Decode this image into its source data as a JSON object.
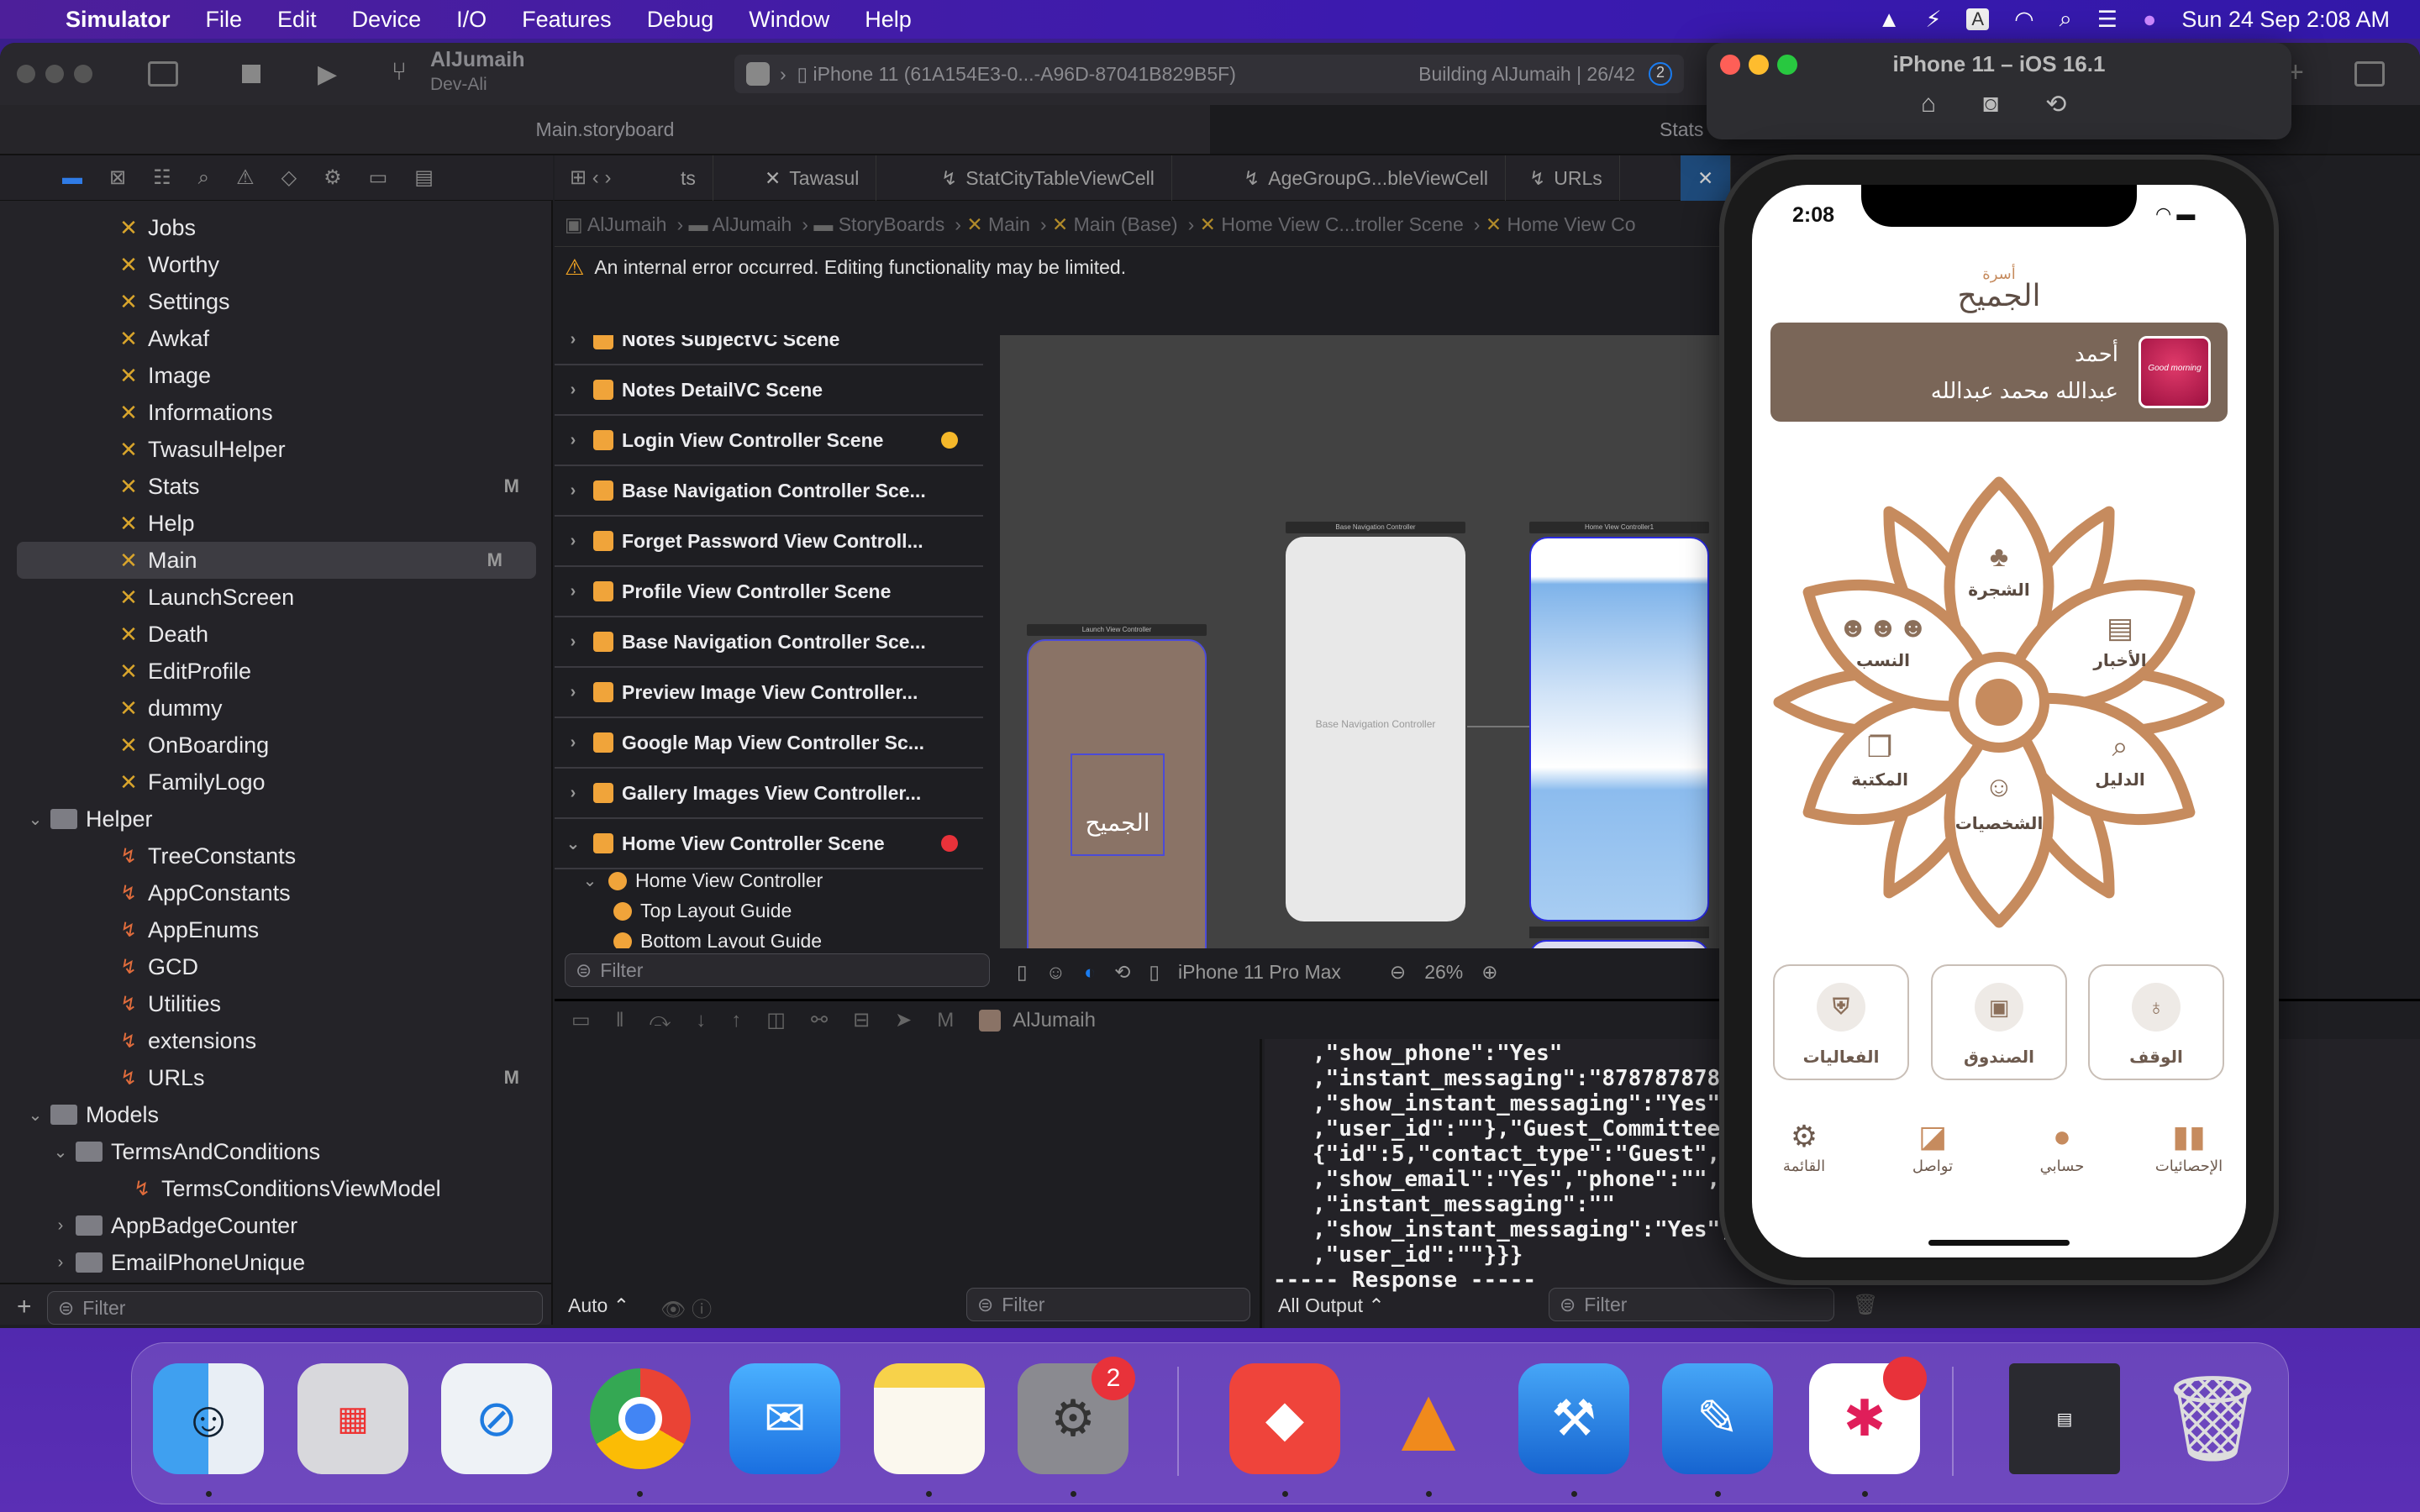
{
  "menubar": {
    "app": "Simulator",
    "items": [
      "File",
      "Edit",
      "Device",
      "I/O",
      "Features",
      "Debug",
      "Window",
      "Help"
    ],
    "clock": "Sun 24 Sep  2:08 AM"
  },
  "xcode": {
    "project": "AlJumaih",
    "branch": "Dev-Ali",
    "scheme_device": "iPhone 11 (61A154E3-0...-A96D-87041B829B5F)",
    "status": "Building AlJumaih | 26/42",
    "status_count": "2",
    "file_tab": "Main.storyboard",
    "file_tab2": "Stats",
    "editor_tabs": [
      "ts",
      "Tawasul",
      "StatCityTableViewCell",
      "AgeGroupG...bleViewCell",
      "URLs"
    ],
    "breadcrumb": [
      "AlJumaih",
      "AlJumaih",
      "StoryBoards",
      "Main",
      "Main (Base)",
      "Home View C...troller Scene",
      "Home View Co"
    ],
    "warning": "An internal error occurred. Editing functionality may be limited.",
    "navigator": [
      {
        "label": "Jobs",
        "type": "sb",
        "level": 2
      },
      {
        "label": "Worthy",
        "type": "sb",
        "level": 2
      },
      {
        "label": "Settings",
        "type": "sb",
        "level": 2
      },
      {
        "label": "Awkaf",
        "type": "sb",
        "level": 2
      },
      {
        "label": "Image",
        "type": "sb",
        "level": 2
      },
      {
        "label": "Informations",
        "type": "sb",
        "level": 2
      },
      {
        "label": "TwasulHelper",
        "type": "sb",
        "level": 2
      },
      {
        "label": "Stats",
        "type": "sb",
        "level": 2,
        "badge": "M"
      },
      {
        "label": "Help",
        "type": "sb",
        "level": 2
      },
      {
        "label": "Main",
        "type": "sb",
        "level": 2,
        "badge": "M",
        "selected": true
      },
      {
        "label": "LaunchScreen",
        "type": "sb",
        "level": 2
      },
      {
        "label": "Death",
        "type": "sb",
        "level": 2
      },
      {
        "label": "EditProfile",
        "type": "sb",
        "level": 2
      },
      {
        "label": "dummy",
        "type": "sb",
        "level": 2
      },
      {
        "label": "OnBoarding",
        "type": "sb",
        "level": 2
      },
      {
        "label": "FamilyLogo",
        "type": "sb",
        "level": 2
      },
      {
        "label": "Helper",
        "type": "folder",
        "level": 1,
        "open": true
      },
      {
        "label": "TreeConstants",
        "type": "swift",
        "level": 2
      },
      {
        "label": "AppConstants",
        "type": "swift",
        "level": 2
      },
      {
        "label": "AppEnums",
        "type": "swift",
        "level": 2
      },
      {
        "label": "GCD",
        "type": "swift",
        "level": 2
      },
      {
        "label": "Utilities",
        "type": "swift",
        "level": 2
      },
      {
        "label": "extensions",
        "type": "swift",
        "level": 2
      },
      {
        "label": "URLs",
        "type": "swift",
        "level": 2,
        "badge": "M"
      },
      {
        "label": "Models",
        "type": "folder",
        "level": 1,
        "open": true
      },
      {
        "label": "TermsAndConditions",
        "type": "folder",
        "level": 2,
        "open": true
      },
      {
        "label": "TermsConditionsViewModel",
        "type": "swift",
        "level": 3
      },
      {
        "label": "AppBadgeCounter",
        "type": "folder",
        "level": 2,
        "open": false
      },
      {
        "label": "EmailPhoneUnique",
        "type": "folder",
        "level": 2,
        "open": false
      }
    ],
    "sidebar_filter": "Filter",
    "outline": [
      {
        "label": "Notes SubjectVC Scene"
      },
      {
        "label": "Notes DetailVC Scene"
      },
      {
        "label": "Login View Controller Scene",
        "marker": "yellow"
      },
      {
        "label": "Base Navigation Controller Sce..."
      },
      {
        "label": "Forget Password View Controll..."
      },
      {
        "label": "Profile View Controller Scene"
      },
      {
        "label": "Base Navigation Controller Sce..."
      },
      {
        "label": "Preview Image View Controller..."
      },
      {
        "label": "Google Map View Controller Sc..."
      },
      {
        "label": "Gallery Images View Controller..."
      },
      {
        "label": "Home View Controller Scene",
        "marker": "red",
        "open": true
      }
    ],
    "outline_children": [
      "Home View Controller",
      "Top Layout Guide",
      "Bottom Layout Guide"
    ],
    "outline_filter": "Filter",
    "scenes": {
      "launch": "Launch View Controller",
      "nav": "Base Navigation Controller",
      "nav_body": "Base Navigation Controller",
      "home": "Home View Controller1"
    },
    "canvas_device": "iPhone 11 Pro Max",
    "zoom": "26%",
    "debug_target": "AlJumaih",
    "variables_mode": "Auto",
    "variables_filter": "Filter",
    "console_lines": [
      "   ,\"show_phone\":\"Yes\"",
      "   ,\"instant_messaging\":\"87878787878",
      "   ,\"show_instant_messaging\":\"Yes\",",
      "   ,\"user_id\":\"\"},\"Guest_Committee_",
      "   {\"id\":5,\"contact_type\":\"Guest\",\"",
      "   ,\"show_email\":\"Yes\",\"phone\":\"\",\"",
      "   ,\"instant_messaging\":\"\"",
      "   ,\"show_instant_messaging\":\"Yes\",",
      "   ,\"user_id\":\"\"}}}",
      "----- Response -----"
    ],
    "console_mode": "All Output",
    "console_filter": "Filter"
  },
  "simulator": {
    "title": "iPhone 11 – iOS 16.1",
    "time": "2:08",
    "logo_top": "أسرة",
    "logo": "الجميح",
    "user_first": "أحمد",
    "user_full": "عبدالله محمد عبدالله",
    "avatar_text": "Good morning",
    "petals": [
      "الشجرة",
      "الأخبار",
      "الدليل",
      "الشخصيات",
      "المكتبة",
      "النسب"
    ],
    "cards": [
      "الفعاليات",
      "الصندوق",
      "الوقف"
    ],
    "tabs": [
      "القائمة",
      "تواصل",
      "حسابي",
      "الإحصائيات"
    ],
    "accent": "#c68b5e",
    "card_bg": "#7a6658"
  },
  "dock": {
    "apps": [
      "Finder",
      "Launchpad",
      "Safari",
      "Google Chrome",
      "Mail",
      "Notes",
      "System Settings",
      "AnyDesk",
      "VLC",
      "Xcode",
      "Simulator",
      "Slack",
      "Screenshot",
      "Trash"
    ],
    "settings_badge": "2"
  }
}
